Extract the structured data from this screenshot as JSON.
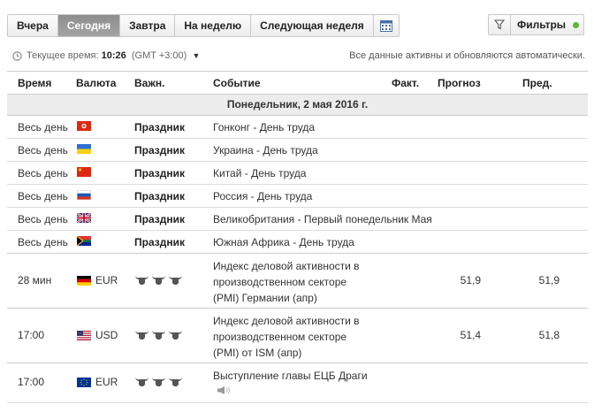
{
  "tabs": [
    {
      "label": "Вчера",
      "active": false
    },
    {
      "label": "Сегодня",
      "active": true
    },
    {
      "label": "Завтра",
      "active": false
    },
    {
      "label": "На неделю",
      "active": false
    },
    {
      "label": "Следующая неделя",
      "active": false
    }
  ],
  "calendar_icon": "calendar-icon",
  "filters": {
    "label": "Фильтры",
    "icon": "filter-icon",
    "status_color": "#5fb735"
  },
  "time": {
    "label": "Текущее время:",
    "value": "10:26",
    "tz": "(GMT +3:00)",
    "note": "Все данные активны и обновляются автоматически."
  },
  "columns": {
    "time": "Время",
    "currency": "Валюта",
    "importance": "Важн.",
    "event": "Событие",
    "actual": "Факт.",
    "forecast": "Прогноз",
    "previous": "Пред."
  },
  "day_header": "Понедельник, 2 мая 2016 г.",
  "holidays": [
    {
      "time": "Весь день",
      "flag": "hk",
      "importance": "Праздник",
      "event": "Гонконг - День труда"
    },
    {
      "time": "Весь день",
      "flag": "ua",
      "importance": "Праздник",
      "event": "Украина - День труда"
    },
    {
      "time": "Весь день",
      "flag": "cn",
      "importance": "Праздник",
      "event": "Китай - День труда"
    },
    {
      "time": "Весь день",
      "flag": "ru",
      "importance": "Праздник",
      "event": "Россия - День труда"
    },
    {
      "time": "Весь день",
      "flag": "gb",
      "importance": "Праздник",
      "event": "Великобритания - Первый понедельник Мая"
    },
    {
      "time": "Весь день",
      "flag": "za",
      "importance": "Праздник",
      "event": "Южная Африка - День труда"
    }
  ],
  "events": [
    {
      "time": "28 мин",
      "flag": "de",
      "currency": "EUR",
      "bulls": 3,
      "event_lines": [
        "Индекс деловой активности в",
        "производственном секторе",
        "(PMI) Германии (апр)"
      ],
      "actual": "",
      "forecast": "51,9",
      "previous": "51,9"
    },
    {
      "time": "17:00",
      "flag": "us",
      "currency": "USD",
      "bulls": 3,
      "event_lines": [
        "Индекс деловой активности в",
        "производственном секторе",
        "(PMI) от ISM (апр)"
      ],
      "actual": "",
      "forecast": "51,4",
      "previous": "51,8"
    },
    {
      "time": "17:00",
      "flag": "eu",
      "currency": "EUR",
      "bulls": 3,
      "event_lines": [
        "Выступление главы ЕЦБ Драги"
      ],
      "speech_icon": "speaker-icon",
      "actual": "",
      "forecast": "",
      "previous": ""
    }
  ]
}
